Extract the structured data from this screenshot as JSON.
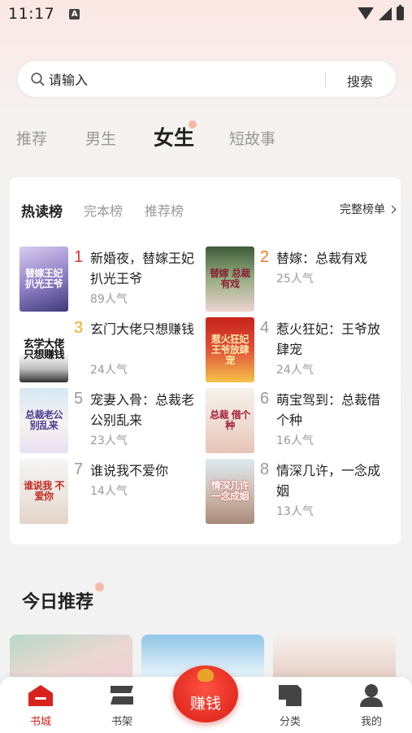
{
  "status_bar": {
    "time": "11:17",
    "notification_badge": "A"
  },
  "search": {
    "placeholder": "请输入",
    "value": "",
    "button_label": "搜索"
  },
  "category_tabs": [
    {
      "label": "推荐",
      "active": false
    },
    {
      "label": "男生",
      "active": false
    },
    {
      "label": "女生",
      "active": true
    },
    {
      "label": "短故事",
      "active": false
    }
  ],
  "ranking": {
    "tabs": [
      {
        "label": "热读榜",
        "active": true
      },
      {
        "label": "完本榜",
        "active": false
      },
      {
        "label": "推荐榜",
        "active": false
      }
    ],
    "full_list_label": "完整榜单",
    "books": [
      {
        "rank": "1",
        "title": "新婚夜，替嫁王妃扒光王爷",
        "popularity": "89人气",
        "cover_text": "替嫁王妃 扒光王爷",
        "cover_colors": [
          "#c9b8e6",
          "#6c5aa8"
        ]
      },
      {
        "rank": "2",
        "title": "替嫁：总裁有戏",
        "popularity": "25人气",
        "cover_text": "替嫁 总裁有戏",
        "cover_colors": [
          "#6a8a5a",
          "#e9d3cf"
        ]
      },
      {
        "rank": "3",
        "title": "玄门大佬只想赚钱",
        "popularity": "24人气",
        "cover_text": "玄学大佬 只想赚钱",
        "cover_colors": [
          "#ffffff",
          "#333333"
        ]
      },
      {
        "rank": "4",
        "title": "惹火狂妃：王爷放肆宠",
        "popularity": "24人气",
        "cover_text": "惹火狂妃 王爷放肆宠",
        "cover_colors": [
          "#d8392b",
          "#f4c34a"
        ]
      },
      {
        "rank": "5",
        "title": "宠妻入骨：总裁老公别乱来",
        "popularity": "23人气",
        "cover_text": "总裁老公 别乱来",
        "cover_colors": [
          "#cfe3f3",
          "#f6f2ee"
        ]
      },
      {
        "rank": "6",
        "title": "萌宝驾到：总裁借个种",
        "popularity": "16人气",
        "cover_text": "总裁 借个种",
        "cover_colors": [
          "#f4f0ea",
          "#e6c6b8"
        ]
      },
      {
        "rank": "7",
        "title": "谁说我不爱你",
        "popularity": "14人气",
        "cover_text": "谁说我 不爱你",
        "cover_colors": [
          "#f2f2f2",
          "#e4d6cc"
        ]
      },
      {
        "rank": "8",
        "title": "情深几许，一念成姻",
        "popularity": "13人气",
        "cover_text": "情深几许 一念成姻",
        "cover_colors": [
          "#d8e8ef",
          "#b89e90"
        ]
      }
    ]
  },
  "today_section": {
    "title": "今日推荐"
  },
  "bottom_nav": [
    {
      "label": "书城",
      "icon": "bookstore-icon",
      "active": true
    },
    {
      "label": "书架",
      "icon": "bookshelf-icon",
      "active": false
    },
    {
      "label": "赚钱",
      "icon": "red-envelope-icon",
      "active": false
    },
    {
      "label": "分类",
      "icon": "category-icon",
      "active": false
    },
    {
      "label": "我的",
      "icon": "profile-icon",
      "active": false
    }
  ],
  "colors": {
    "accent_red": "#d7231c",
    "rank_red": "#e8313b",
    "rank_orange": "#f07a24",
    "rank_grey": "#999999",
    "pink_dot": "#f6b9a7"
  }
}
